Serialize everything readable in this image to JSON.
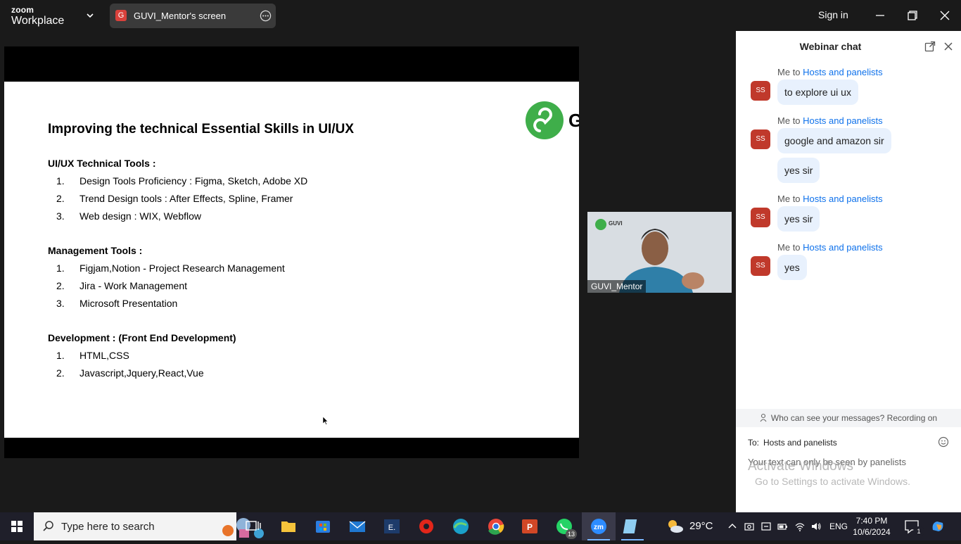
{
  "app": {
    "brand_top": "zoom",
    "brand_bottom": "Workplace"
  },
  "share_tab": {
    "label": "GUVI_Mentor's screen",
    "badge_letter": "G"
  },
  "header": {
    "sign_in": "Sign in"
  },
  "slide": {
    "title": "Improving the technical Essential Skills in UI/UX",
    "logo_letter": "G",
    "sections": [
      {
        "heading": "UI/UX Technical Tools :",
        "items": [
          {
            "num": "1.",
            "text": "Design Tools Proficiency : Figma, Sketch, Adobe XD"
          },
          {
            "num": "2.",
            "text": "Trend Design tools : After Effects, Spline, Framer"
          },
          {
            "num": "3.",
            "text": "Web design : WIX, Webflow"
          }
        ]
      },
      {
        "heading": "Management Tools :",
        "items": [
          {
            "num": "1.",
            "text": "Figjam,Notion - Project Research Management"
          },
          {
            "num": "2.",
            "text": "Jira - Work Management"
          },
          {
            "num": "3.",
            "text": "Microsoft Presentation"
          }
        ]
      },
      {
        "heading": "Development : (Front End Development)",
        "items": [
          {
            "num": "1.",
            "text": "HTML,CSS"
          },
          {
            "num": "2.",
            "text": "Javascript,Jquery,React,Vue"
          }
        ]
      }
    ]
  },
  "video": {
    "name": "GUVI_Mentor",
    "logo_text": "GUVI"
  },
  "chat": {
    "title": "Webinar chat",
    "messages": [
      {
        "from": "Me",
        "sep": "to",
        "to": "Hosts and panelists",
        "avatar": "SS",
        "bubbles": [
          "to explore ui ux"
        ]
      },
      {
        "from": "Me",
        "sep": "to",
        "to": "Hosts and panelists",
        "avatar": "SS",
        "bubbles": [
          "google and amazon sir",
          "yes sir"
        ]
      },
      {
        "from": "Me",
        "sep": "to",
        "to": "Hosts and panelists",
        "avatar": "SS",
        "bubbles": [
          "yes sir"
        ]
      },
      {
        "from": "Me",
        "sep": "to",
        "to": "Hosts and panelists",
        "avatar": "SS",
        "bubbles": [
          "yes"
        ]
      }
    ],
    "privacy": "Who can see your messages? Recording on",
    "to_label": "To:",
    "recipient": "Hosts and panelists",
    "input_placeholder": "Your text can only be seen by panelists"
  },
  "watermark": {
    "line1": "Activate Windows",
    "line2": "Go to Settings to activate Windows."
  },
  "taskbar": {
    "search_placeholder": "Type here to search",
    "whatsapp_badge": "13",
    "temperature": "29°C",
    "language": "ENG",
    "time": "7:40 PM",
    "date": "10/6/2024",
    "notification_count": "1"
  },
  "colors": {
    "accent": "#0e71eb",
    "avatar": "#c0392b",
    "bubble": "#e8f1fd",
    "guvi_green": "#3fae4a"
  }
}
